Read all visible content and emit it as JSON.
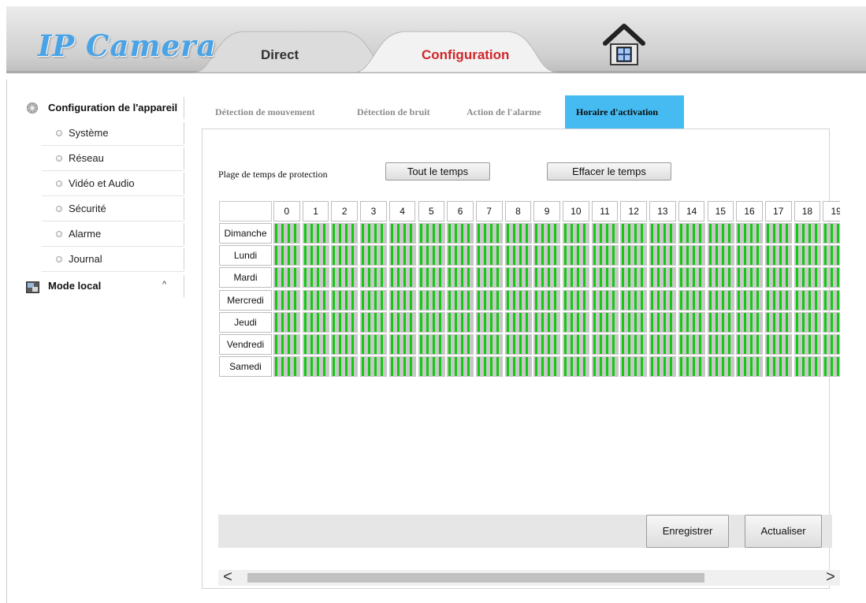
{
  "header": {
    "logo_text": "IP Camera",
    "tabs": [
      {
        "label": "Direct",
        "active": false
      },
      {
        "label": "Configuration",
        "active": true
      }
    ],
    "home_icon": "home-icon"
  },
  "sidebar": {
    "group_device": {
      "icon": "gear-icon",
      "label": "Configuration de l'appareil",
      "items": [
        {
          "label": "Système"
        },
        {
          "label": "Réseau"
        },
        {
          "label": "Vidéo et Audio"
        },
        {
          "label": "Sécurité"
        },
        {
          "label": "Alarme"
        },
        {
          "label": "Journal"
        }
      ]
    },
    "group_local": {
      "icon": "local-mode-icon",
      "label": "Mode local",
      "toggle": "^"
    }
  },
  "subtabs": [
    {
      "label": "Détection de mouvement",
      "active": false
    },
    {
      "label": "Détection de bruit",
      "active": false
    },
    {
      "label": "Action de l'alarme",
      "active": false
    },
    {
      "label": "Horaire d'activation",
      "active": true
    }
  ],
  "schedule": {
    "range_label": "Plage de temps de protection",
    "btn_all": "Tout le temps",
    "btn_clear": "Effacer le temps",
    "hours": [
      "0",
      "1",
      "2",
      "3",
      "4",
      "5",
      "6",
      "7",
      "8",
      "9",
      "10",
      "11",
      "12",
      "13",
      "14",
      "15",
      "16",
      "17",
      "18",
      "19"
    ],
    "days": [
      "Dimanche",
      "Lundi",
      "Mardi",
      "Mercredi",
      "Jeudi",
      "Vendredi",
      "Samedi"
    ],
    "slots_per_hour": 4,
    "all_active": true,
    "active_color": "#14c814"
  },
  "actions": {
    "save": "Enregistrer",
    "refresh": "Actualiser"
  },
  "scrollbar": {
    "left": "<",
    "right": ">"
  }
}
